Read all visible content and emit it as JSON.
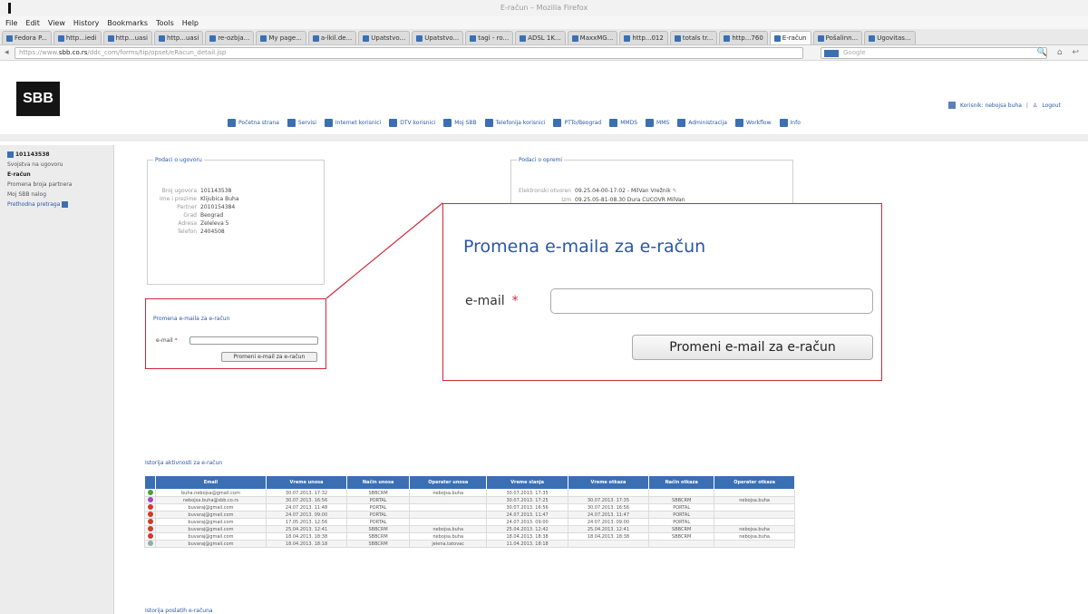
{
  "browser": {
    "window_title": "E-račun – Mozilla Firefox",
    "menu": [
      "File",
      "Edit",
      "View",
      "History",
      "Bookmarks",
      "Tools",
      "Help"
    ],
    "tabs": [
      {
        "label": "Fedora P..."
      },
      {
        "label": "http...iedi"
      },
      {
        "label": "http...uasi"
      },
      {
        "label": "http...uasi"
      },
      {
        "label": "re-ozbja..."
      },
      {
        "label": "My page..."
      },
      {
        "label": "a-lkil.de..."
      },
      {
        "label": "Upatstvo..."
      },
      {
        "label": "Upatstvo..."
      },
      {
        "label": "tagi - ro..."
      },
      {
        "label": "ADSL 1K..."
      },
      {
        "label": "MaxxMG..."
      },
      {
        "label": "http...012"
      },
      {
        "label": "totals tr..."
      },
      {
        "label": "http...760"
      },
      {
        "label": "E-račun"
      },
      {
        "label": "Pošalinn..."
      },
      {
        "label": "Ugovitas..."
      }
    ],
    "url_prefix": "https://www.",
    "url_domain": "sbb.co.rs",
    "url_rest": "/ddc_com/forms/tip/opset/eRacun_detail.jsp",
    "search_placeholder": "Google"
  },
  "header": {
    "logo": "SBB",
    "user_name": "Korisnik: nebojsa buha",
    "logout": "Logout",
    "nav": [
      "Početna strana",
      "Servisi",
      "Internet korisnici",
      "DTV korisnici",
      "Moj SBB",
      "Telefonija korisnici",
      "PTTo/Beograd",
      "MMDS",
      "MMS",
      "Administracija",
      "Workflow",
      "Info"
    ]
  },
  "sidebar": {
    "account": "101143538",
    "items": [
      "Svojstva na ugovoru",
      "E-račun",
      "Promena broja partnera",
      "Moj SBB nalog"
    ],
    "link": "Prethodna pretraga"
  },
  "contract": {
    "legend": "Podaci o ugovoru",
    "rows": [
      {
        "k": "Broj ugovora",
        "v": "101143538"
      },
      {
        "k": "Ime i prezime",
        "v": "Klijubica Buha"
      },
      {
        "k": "Partner",
        "v": "2010154384"
      },
      {
        "k": "Grad",
        "v": "Beograd"
      },
      {
        "k": "Adresa",
        "v": "Zeleleva 5"
      },
      {
        "k": "Telefon",
        "v": "2404508"
      }
    ]
  },
  "service": {
    "legend": "Podaci o opremi",
    "row1_k": "Elektronski otvoren",
    "row1_v": "09.25.04-00-17:02 - MilVan Vrežnik",
    "row2_k": "Izm",
    "row2_v": "09.25.05-81-08.30 Dura CUCOVR MilVan"
  },
  "email_form": {
    "title": "Promena e-maila za e-račun",
    "label": "e-mail",
    "required": "*",
    "button": "Promeni e-mail za e-račun"
  },
  "activity": {
    "title": "Istorija aktivnosti za e-račun",
    "columns": [
      "",
      "Email",
      "Vreme unosa",
      "Način unosa",
      "Operater unosa",
      "Vreme slanja",
      "Vreme otkaza",
      "Način otkaza",
      "Operater otkaza"
    ],
    "rows": [
      {
        "status": "green",
        "email": "buha.nebojsa@gmail.com",
        "unos": "30.07.2013. 17:32",
        "nacin": "SBBCRM",
        "operater": "nebojsa.buha",
        "slanje": "30.07.2013. 17:35",
        "otkaz": "",
        "nacin_otkaza": "",
        "operater_otkaza": ""
      },
      {
        "status": "purple",
        "email": "nebojsa.buha@sbb.co.rs",
        "unos": "30.07.2013. 16:56",
        "nacin": "PORTAL",
        "operater": "",
        "slanje": "30.07.2013. 17:25",
        "otkaz": "30.07.2013. 17:35",
        "nacin_otkaza": "SBBCRM",
        "operater_otkaza": "nebojsa.buha"
      },
      {
        "status": "red",
        "email": "buvaraj@gmail.com",
        "unos": "24.07.2013. 11:48",
        "nacin": "PORTAL",
        "operater": "",
        "slanje": "30.07.2013. 16:56",
        "otkaz": "30.07.2013. 16:56",
        "nacin_otkaza": "PORTAL",
        "operater_otkaza": ""
      },
      {
        "status": "red",
        "email": "buvaraj@gmail.com",
        "unos": "24.07.2013. 09:00",
        "nacin": "PORTAL",
        "operater": "",
        "slanje": "24.07.2013. 11:47",
        "otkaz": "24.07.2013. 11:47",
        "nacin_otkaza": "PORTAL",
        "operater_otkaza": ""
      },
      {
        "status": "red",
        "email": "buvaraj@gmail.com",
        "unos": "17.05.2013. 12:56",
        "nacin": "PORTAL",
        "operater": "",
        "slanje": "24.07.2013. 09:00",
        "otkaz": "24.07.2013. 09:00",
        "nacin_otkaza": "PORTAL",
        "operater_otkaza": ""
      },
      {
        "status": "red",
        "email": "buvaraj@gmail.com",
        "unos": "25.04.2013. 12:41",
        "nacin": "SBBCRM",
        "operater": "nebojsa.buha",
        "slanje": "25.04.2013. 12:42",
        "otkaz": "25.04.2013. 12:41",
        "nacin_otkaza": "SBBCRM",
        "operater_otkaza": "nebojsa.buha"
      },
      {
        "status": "red",
        "email": "buvaraj@gmail.com",
        "unos": "18.04.2013. 18:38",
        "nacin": "SBBCRM",
        "operater": "nebojsa.buha",
        "slanje": "18.04.2013. 18:38",
        "otkaz": "18.04.2013. 18:38",
        "nacin_otkaza": "SBBCRM",
        "operater_otkaza": "nebojsa.buha"
      },
      {
        "status": "gray",
        "email": "buvaraj@gmail.com",
        "unos": "18.04.2013. 18:18",
        "nacin": "SBBCRM",
        "operater": "jelena.tatovac",
        "slanje": "11.04.2013. 18:18",
        "otkaz": "",
        "nacin_otkaza": "",
        "operater_otkaza": ""
      }
    ]
  },
  "sending": {
    "title": "Istorija poslatih e-računa"
  },
  "colors": {
    "accent": "#3a6fb4",
    "highlight": "#cc2a3a",
    "green": "#4aa23a",
    "purple": "#a24ac0",
    "red": "#d23a2a",
    "gray": "#8fb0a0"
  }
}
